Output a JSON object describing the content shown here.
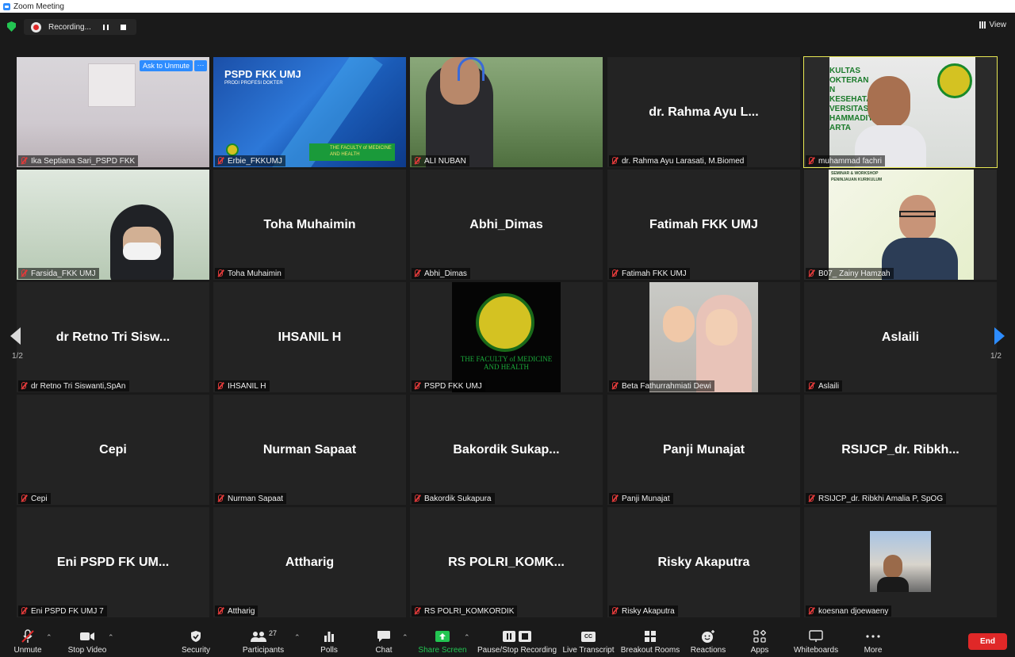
{
  "window": {
    "title": "Zoom Meeting"
  },
  "recording": {
    "status": "Recording..."
  },
  "view_label": "View",
  "pager": {
    "left": "1/2",
    "right": "1/2"
  },
  "ask_unmute": "Ask to Unmute",
  "tiles": [
    {
      "big": "",
      "label": "Ika Septiana Sari_PSPD FKK",
      "kind": "video-room"
    },
    {
      "big": "",
      "label": "Erbie_FKKUMJ",
      "kind": "video-slide",
      "slide_title": "PSPD FKK UMJ",
      "slide_sub": "PRODI PROFESI DOKTER",
      "slide_banner": "THE FACULTY of MEDICINE AND HEALTH"
    },
    {
      "big": "",
      "label": "ALI NUBAN",
      "kind": "video-headset"
    },
    {
      "big": "dr. Rahma Ayu L...",
      "label": "dr. Rahma Ayu Larasati, M.Biomed"
    },
    {
      "big": "",
      "label": "muhammad fachri",
      "kind": "video-speaker",
      "banner_lines": [
        "KULTAS",
        "OKTERAN",
        "N KESEHATAN",
        "VERSITAS",
        "HAMMADIY",
        "ARTA"
      ]
    },
    {
      "big": "",
      "label": "Farsida_FKK UMJ",
      "kind": "video-hijab"
    },
    {
      "big": "Toha Muhaimin",
      "label": "Toha Muhaimin"
    },
    {
      "big": "Abhi_Dimas",
      "label": "Abhi_Dimas"
    },
    {
      "big": "Fatimah FKK UMJ",
      "label": "Fatimah FKK UMJ"
    },
    {
      "big": "",
      "label": "B07_ Zainy Hamzah",
      "kind": "video-glasses",
      "slide_lines": [
        "SEMINAR & WORKSHOP",
        "PENINJAUAN KURIKULUM"
      ]
    },
    {
      "big": "dr Retno Tri Sisw...",
      "label": "dr Retno Tri Siswanti,SpAn"
    },
    {
      "big": "IHSANIL H",
      "label": "IHSANIL H"
    },
    {
      "big": "",
      "label": "PSPD FKK UMJ",
      "kind": "logo",
      "logo_text": "THE FACULTY of MEDICINE AND HEALTH"
    },
    {
      "big": "",
      "label": "Beta Fathurrahmiati Dewi",
      "kind": "photo-family"
    },
    {
      "big": "Aslaili",
      "label": "Aslaili"
    },
    {
      "big": "Cepi",
      "label": "Cepi"
    },
    {
      "big": "Nurman Sapaat",
      "label": "Nurman Sapaat"
    },
    {
      "big": "Bakordik  Sukap...",
      "label": "Bakordik Sukapura"
    },
    {
      "big": "Panji Munajat",
      "label": "Panji Munajat"
    },
    {
      "big": "RSIJCP_dr.  Ribkh...",
      "label": "RSIJCP_dr. Ribkhi Amalia P, SpOG"
    },
    {
      "big": "Eni PSPD FK UM...",
      "label": "Eni PSPD FK UMJ 7"
    },
    {
      "big": "Attharig",
      "label": "Attharig"
    },
    {
      "big": "RS  POLRI_KOMK...",
      "label": "RS POLRI_KOMKORDIK"
    },
    {
      "big": "Risky Akaputra",
      "label": "Risky Akaputra"
    },
    {
      "big": "",
      "label": "koesnan djoewaeny",
      "kind": "photo-small"
    }
  ],
  "toolbar": {
    "unmute": "Unmute",
    "stop_video": "Stop Video",
    "security": "Security",
    "participants": "Participants",
    "participants_count": "27",
    "polls": "Polls",
    "chat": "Chat",
    "share_screen": "Share Screen",
    "pause_stop": "Pause/Stop Recording",
    "live_transcript": "Live Transcript",
    "breakout": "Breakout Rooms",
    "reactions": "Reactions",
    "apps": "Apps",
    "whiteboards": "Whiteboards",
    "more": "More",
    "end": "End",
    "cc_badge": "CC"
  },
  "colors": {
    "accent": "#2d8cff",
    "share_green": "#23c552",
    "end_red": "#e02828",
    "speaker_outline": "#e8e853"
  }
}
